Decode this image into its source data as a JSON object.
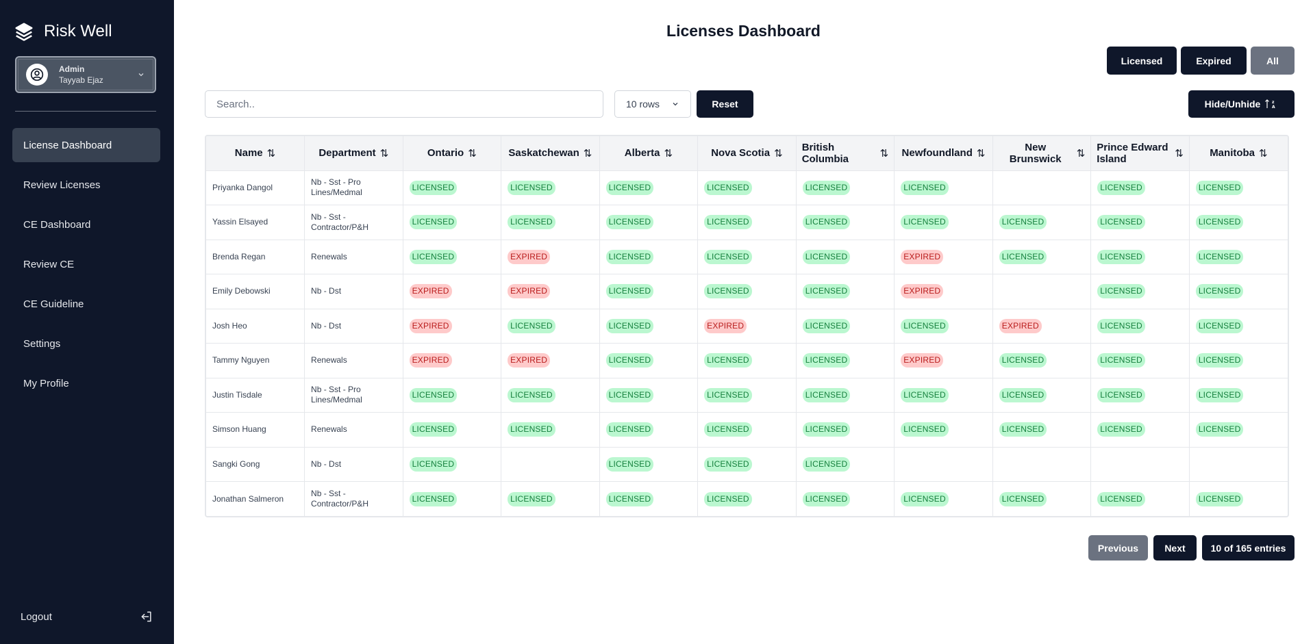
{
  "app": {
    "name": "Risk Well"
  },
  "user": {
    "role": "Admin",
    "name": "Tayyab Ejaz"
  },
  "nav": [
    {
      "label": "License Dashboard",
      "active": true
    },
    {
      "label": "Review Licenses"
    },
    {
      "label": "CE Dashboard"
    },
    {
      "label": "Review CE"
    },
    {
      "label": "CE Guideline"
    },
    {
      "label": "Settings"
    },
    {
      "label": "My Profile"
    }
  ],
  "logout": {
    "label": "Logout"
  },
  "page": {
    "title": "Licenses Dashboard"
  },
  "filters": {
    "licensed": "Licensed",
    "expired": "Expired",
    "all": "All"
  },
  "search": {
    "placeholder": "Search.."
  },
  "rows_select": {
    "value": "10 rows"
  },
  "reset": {
    "label": "Reset"
  },
  "hide_unhide": {
    "label": "Hide/Unhide"
  },
  "table": {
    "columns": [
      "Name",
      "Department",
      "Ontario",
      "Saskatchewan",
      "Alberta",
      "Nova Scotia",
      "British Columbia",
      "Newfoundland",
      "New Brunswick",
      "Prince Edward Island",
      "Manitoba"
    ],
    "rows": [
      [
        "Priyanka Dangol",
        "Nb - Sst - Pro Lines/Medmal",
        "LICENSED",
        "LICENSED",
        "LICENSED",
        "LICENSED",
        "LICENSED",
        "LICENSED",
        "",
        "LICENSED",
        "LICENSED"
      ],
      [
        "Yassin Elsayed",
        "Nb - Sst - Contractor/P&H",
        "LICENSED",
        "LICENSED",
        "LICENSED",
        "LICENSED",
        "LICENSED",
        "LICENSED",
        "LICENSED",
        "LICENSED",
        "LICENSED"
      ],
      [
        "Brenda Regan",
        "Renewals",
        "LICENSED",
        "EXPIRED",
        "LICENSED",
        "LICENSED",
        "LICENSED",
        "EXPIRED",
        "LICENSED",
        "LICENSED",
        "LICENSED"
      ],
      [
        "Emily Debowski",
        "Nb - Dst",
        "EXPIRED",
        "EXPIRED",
        "LICENSED",
        "LICENSED",
        "LICENSED",
        "EXPIRED",
        "",
        "LICENSED",
        "LICENSED"
      ],
      [
        "Josh Heo",
        "Nb - Dst",
        "EXPIRED",
        "LICENSED",
        "LICENSED",
        "EXPIRED",
        "LICENSED",
        "LICENSED",
        "EXPIRED",
        "LICENSED",
        "LICENSED"
      ],
      [
        "Tammy Nguyen",
        "Renewals",
        "EXPIRED",
        "EXPIRED",
        "LICENSED",
        "LICENSED",
        "LICENSED",
        "EXPIRED",
        "LICENSED",
        "LICENSED",
        "LICENSED"
      ],
      [
        "Justin Tisdale",
        "Nb - Sst - Pro Lines/Medmal",
        "LICENSED",
        "LICENSED",
        "LICENSED",
        "LICENSED",
        "LICENSED",
        "LICENSED",
        "LICENSED",
        "LICENSED",
        "LICENSED"
      ],
      [
        "Simson Huang",
        "Renewals",
        "LICENSED",
        "LICENSED",
        "LICENSED",
        "LICENSED",
        "LICENSED",
        "LICENSED",
        "LICENSED",
        "LICENSED",
        "LICENSED"
      ],
      [
        "Sangki Gong",
        "Nb - Dst",
        "LICENSED",
        "",
        "LICENSED",
        "LICENSED",
        "LICENSED",
        "",
        "",
        "",
        ""
      ],
      [
        "Jonathan Salmeron",
        "Nb - Sst - Contractor/P&H",
        "LICENSED",
        "LICENSED",
        "LICENSED",
        "LICENSED",
        "LICENSED",
        "LICENSED",
        "LICENSED",
        "LICENSED",
        "LICENSED"
      ]
    ]
  },
  "pager": {
    "previous": "Previous",
    "next": "Next",
    "entries": "10 of 165 entries"
  },
  "colors": {
    "sidebar": "#0f172a",
    "primary": "#0f172a",
    "licensed_bg": "#bbf7d0",
    "expired_bg": "#fecaca"
  }
}
